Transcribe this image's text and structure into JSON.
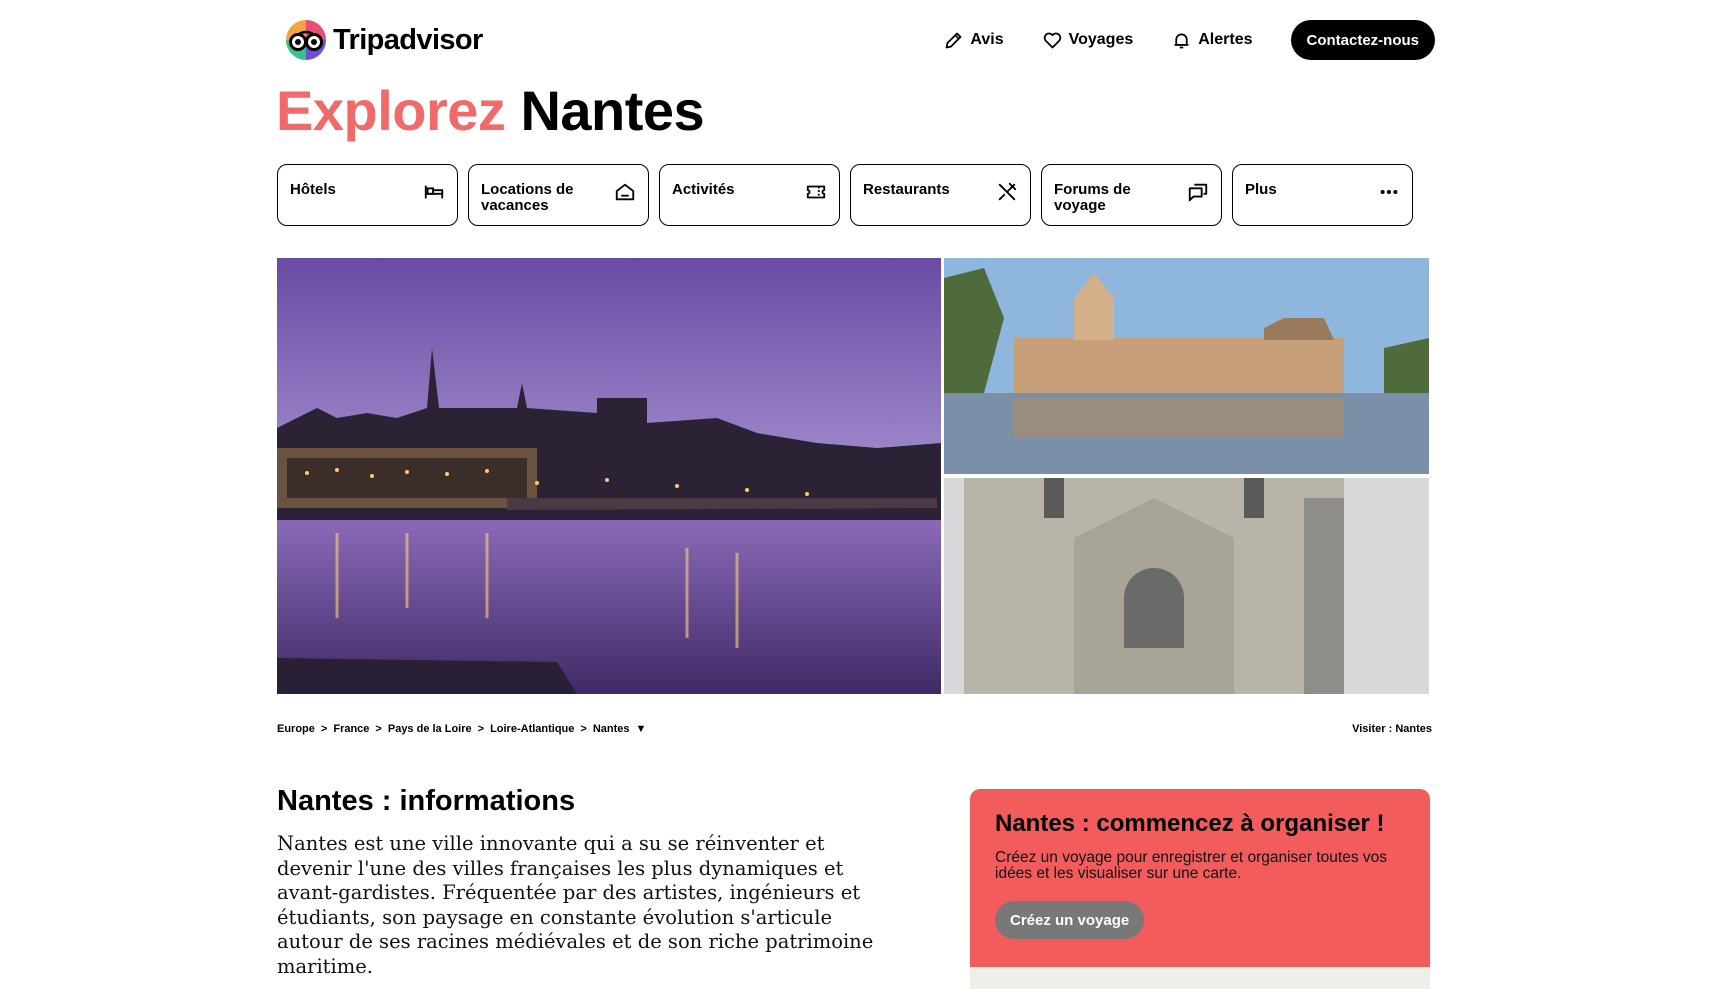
{
  "header": {
    "logo_text": "Tripadvisor",
    "nav": [
      {
        "label": "Avis",
        "icon": "pencil-icon"
      },
      {
        "label": "Voyages",
        "icon": "heart-icon"
      },
      {
        "label": "Alertes",
        "icon": "bell-icon"
      }
    ],
    "contact_label": "Contactez-nous"
  },
  "title": {
    "accent": "Explorez",
    "city": "Nantes"
  },
  "categories": [
    {
      "label": "Hôtels",
      "icon": "bed-icon"
    },
    {
      "label": "Locations de vacances",
      "icon": "house-icon"
    },
    {
      "label": "Activités",
      "icon": "ticket-icon"
    },
    {
      "label": "Restaurants",
      "icon": "utensils-icon"
    },
    {
      "label": "Forums de voyage",
      "icon": "chat-bubbles-icon"
    },
    {
      "label": "Plus",
      "icon": "more-dots-icon"
    }
  ],
  "breadcrumbs": [
    {
      "label": "Europe"
    },
    {
      "label": "France"
    },
    {
      "label": "Pays de la Loire"
    },
    {
      "label": "Loire-Atlantique"
    },
    {
      "label": "Nantes",
      "dropdown": "▼"
    }
  ],
  "breadcrumb_sep": ">",
  "visit_label": "Visiter : Nantes",
  "info": {
    "title": "Nantes : informations",
    "text": "Nantes est une ville innovante qui a su se réinventer et devenir l'une des villes françaises les plus dynamiques et avant-gardistes. Fréquentée par des artistes, ingénieurs et étudiants, son paysage en constante évolution s'articule autour de ses racines médiévales et de son riche patrimoine maritime."
  },
  "promo": {
    "title": "Nantes : commencez à organiser !",
    "text": "Créez un voyage pour enregistrer et organiser toutes vos idées et les visualiser sur une carte.",
    "button": "Créez un voyage"
  },
  "colors": {
    "accent": "#f06a6a",
    "promo_bg": "#f25c5c",
    "button_dark": "#000000",
    "button_gray": "#787878"
  }
}
